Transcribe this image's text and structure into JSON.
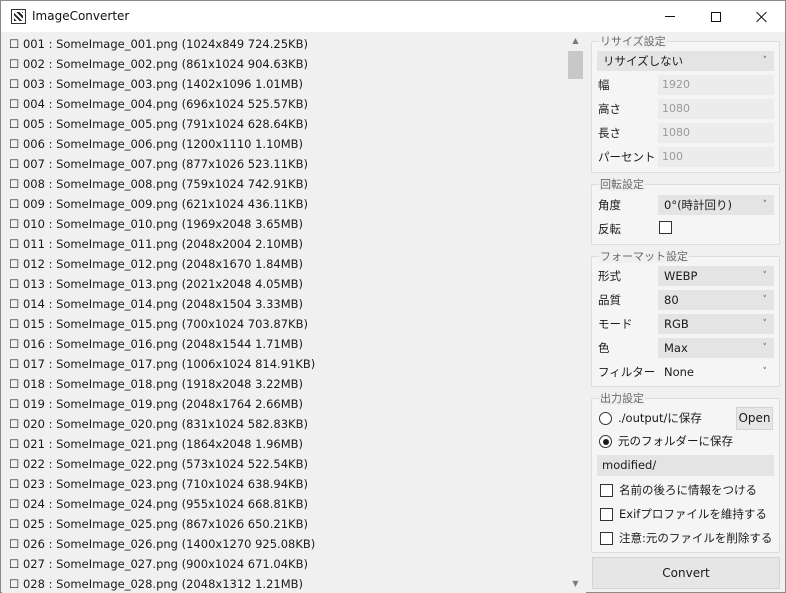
{
  "window": {
    "title": "ImageConverter"
  },
  "file_list": {
    "items": [
      "☐ 001 : SomeImage_001.png (1024x849 724.25KB)",
      "☐ 002 : SomeImage_002.png (861x1024 904.63KB)",
      "☐ 003 : SomeImage_003.png (1402x1096 1.01MB)",
      "☐ 004 : SomeImage_004.png (696x1024 525.57KB)",
      "☐ 005 : SomeImage_005.png (791x1024 628.64KB)",
      "☐ 006 : SomeImage_006.png (1200x1110 1.10MB)",
      "☐ 007 : SomeImage_007.png (877x1026 523.11KB)",
      "☐ 008 : SomeImage_008.png (759x1024 742.91KB)",
      "☐ 009 : SomeImage_009.png (621x1024 436.11KB)",
      "☐ 010 : SomeImage_010.png (1969x2048 3.65MB)",
      "☐ 011 : SomeImage_011.png (2048x2004 2.10MB)",
      "☐ 012 : SomeImage_012.png (2048x1670 1.84MB)",
      "☐ 013 : SomeImage_013.png (2021x2048 4.05MB)",
      "☐ 014 : SomeImage_014.png (2048x1504 3.33MB)",
      "☐ 015 : SomeImage_015.png (700x1024 703.87KB)",
      "☐ 016 : SomeImage_016.png (2048x1544 1.71MB)",
      "☐ 017 : SomeImage_017.png (1006x1024 814.91KB)",
      "☐ 018 : SomeImage_018.png (1918x2048 3.22MB)",
      "☐ 019 : SomeImage_019.png (2048x1764 2.66MB)",
      "☐ 020 : SomeImage_020.png (831x1024 582.83KB)",
      "☐ 021 : SomeImage_021.png (1864x2048 1.96MB)",
      "☐ 022 : SomeImage_022.png (573x1024 522.54KB)",
      "☐ 023 : SomeImage_023.png (710x1024 638.94KB)",
      "☐ 024 : SomeImage_024.png (955x1024 668.81KB)",
      "☐ 025 : SomeImage_025.png (867x1026 650.21KB)",
      "☐ 026 : SomeImage_026.png (1400x1270 925.08KB)",
      "☐ 027 : SomeImage_027.png (900x1024 671.04KB)",
      "☐ 028 : SomeImage_028.png (2048x1312 1.21MB)"
    ]
  },
  "resize": {
    "title": "リサイズ設定",
    "mode": "リサイズしない",
    "width_label": "幅",
    "width_value": "1920",
    "height_label": "高さ",
    "height_value": "1080",
    "long_label": "長さ",
    "long_value": "1080",
    "percent_label": "パーセント",
    "percent_value": "100"
  },
  "rotate": {
    "title": "回転設定",
    "angle_label": "角度",
    "angle_value": "0°(時計回り)",
    "flip_label": "反転"
  },
  "format": {
    "title": "フォーマット設定",
    "type_label": "形式",
    "type_value": "WEBP",
    "quality_label": "品質",
    "quality_value": "80",
    "mode_label": "モード",
    "mode_value": "RGB",
    "color_label": "色",
    "color_value": "Max",
    "filter_label": "フィルター",
    "filter_value": "None"
  },
  "output": {
    "title": "出力設定",
    "option_output_folder": "./output/に保存",
    "open_button": "Open",
    "option_source_folder": "元のフォルダーに保存",
    "folder_value": "modified/",
    "append_info": "名前の後ろに情報をつける",
    "keep_exif": "Exifプロファイルを維持する",
    "delete_original": "注意:元のファイルを削除する"
  },
  "actions": {
    "convert_button": "Convert"
  },
  "icons": {
    "app": "image-converter-icon",
    "minimize": "minimize-icon",
    "maximize": "maximize-icon",
    "close": "close-icon",
    "dropdown": "chevron-down-icon",
    "scroll_up": "scroll-up-arrow-icon",
    "scroll_down": "scroll-down-arrow-icon"
  }
}
